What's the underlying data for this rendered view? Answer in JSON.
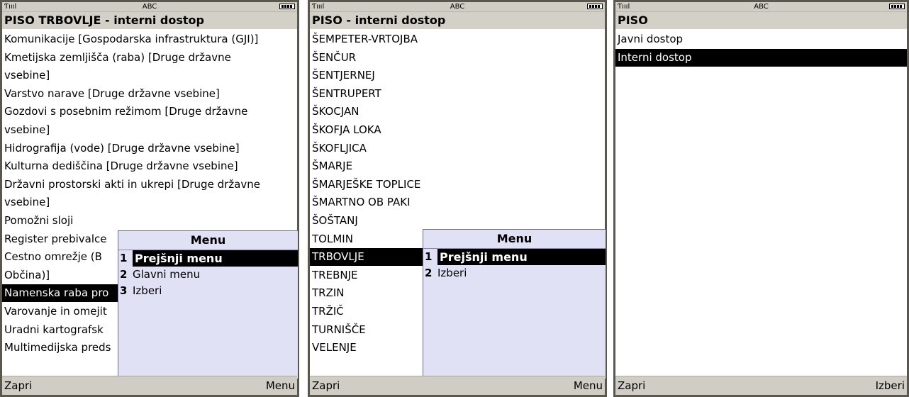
{
  "screens": [
    {
      "status": {
        "signal": "Ƭıııl",
        "mode": "ABC"
      },
      "title": "PISO TRBOVLJE - interni dostop",
      "items": [
        "Komunikacije [Gospodarska infrastruktura (GJI)]",
        "Kmetijska zemljišča (raba) [Druge državne",
        "vsebine]",
        "Varstvo narave [Druge državne vsebine]",
        "Gozdovi s posebnim režimom [Druge državne",
        "vsebine]",
        "Hidrografija (vode) [Druge državne vsebine]",
        "Kulturna dediščina [Druge državne vsebine]",
        "Državni prostorski akti in ukrepi [Druge državne",
        "vsebine]",
        "Pomožni sloji",
        "Register prebivalce",
        "Cestno omrežje (B",
        "Občina)]",
        "Namenska raba pro",
        "Varovanje in omejit",
        "Uradni kartografsk",
        "Multimedijska preds"
      ],
      "selected_index": 14,
      "menu": {
        "title": "Menu",
        "items": [
          {
            "num": "1",
            "label": "Prejšnji menu"
          },
          {
            "num": "2",
            "label": "Glavni menu"
          },
          {
            "num": "3",
            "label": "Izberi"
          }
        ],
        "selected_index": 0
      },
      "softkeys": {
        "left": "Zapri",
        "right": "Menu"
      }
    },
    {
      "status": {
        "signal": "Ƭıııl",
        "mode": "ABC"
      },
      "title": "PISO - interni dostop",
      "items": [
        "ŠEMPETER-VRTOJBA",
        "ŠENČUR",
        "ŠENTJERNEJ",
        "ŠENTRUPERT",
        "ŠKOCJAN",
        "ŠKOFJA LOKA",
        "ŠKOFLJICA",
        "ŠMARJE",
        "ŠMARJEŠKE TOPLICE",
        "ŠMARTNO OB PAKI",
        "ŠOŠTANJ",
        "TOLMIN",
        "TRBOVLJE",
        "TREBNJE",
        "TRZIN",
        "TRŽIČ",
        "TURNIŠČE",
        "VELENJE"
      ],
      "selected_index": 12,
      "menu": {
        "title": "Menu",
        "items": [
          {
            "num": "1",
            "label": "Prejšnji menu"
          },
          {
            "num": "2",
            "label": "Izberi"
          }
        ],
        "selected_index": 0
      },
      "softkeys": {
        "left": "Zapri",
        "right": "Menu"
      }
    },
    {
      "status": {
        "signal": "Ƭıııl",
        "mode": "ABC"
      },
      "title": "PISO",
      "items": [
        "Javni dostop",
        "Interni dostop"
      ],
      "selected_index": 1,
      "softkeys": {
        "left": "Zapri",
        "right": "Izberi"
      }
    }
  ],
  "colors": {
    "chrome": "#cfcdc4",
    "menu_bg": "#e1e1f6",
    "selection": "#000000"
  }
}
